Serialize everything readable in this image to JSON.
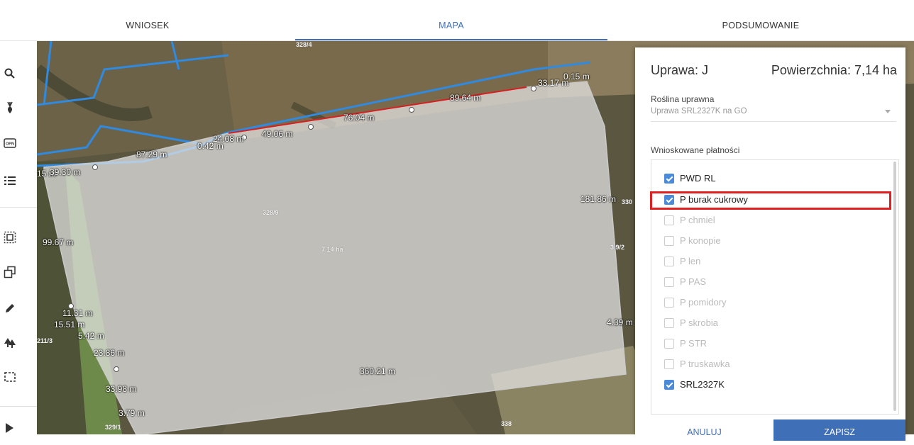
{
  "tabs": [
    {
      "label": "WNIOSEK",
      "active": false
    },
    {
      "label": "MAPA",
      "active": true
    },
    {
      "label": "PODSUMOWANIE",
      "active": false
    }
  ],
  "toolbar": {
    "items": [
      "search-icon",
      "beet-icon",
      "opn-icon",
      "list-icon",
      "select-area-icon",
      "copy-icon",
      "pencil-icon",
      "trees-icon",
      "crop-select-icon",
      "play-icon"
    ],
    "opn_text": "OPN"
  },
  "map": {
    "parcel_labels": [
      "328/4",
      "328/9",
      "7.14 ha",
      "3.9/2",
      "330",
      "211/3",
      "329/1",
      "338"
    ],
    "measurements": [
      "0.15 m",
      "33.17 m",
      "89.64 m",
      "76.04 m",
      "49.06 m",
      "24.08 m",
      "0.42 m",
      "87.29 m",
      "15 m",
      "39.30 m",
      "181.86 m",
      "99.67 m",
      "11.31 m",
      "15.51 m",
      "5.42 m",
      "23.86 m",
      "4.39 m",
      "360.21 m",
      "33.98 m",
      "3.79 m"
    ]
  },
  "panel": {
    "uprawa_label": "Uprawa: J",
    "area_label": "Powierzchnia: 7,14 ha",
    "crop_label": "Roślina uprawna",
    "crop_value": "Uprawa SRL2327K na GO",
    "payments_label": "Wnioskowane płatności",
    "payments": [
      {
        "label": "PWD RL",
        "checked": true,
        "enabled": true
      },
      {
        "label": "P burak cukrowy",
        "checked": true,
        "enabled": true
      },
      {
        "label": "P chmiel",
        "checked": false,
        "enabled": false
      },
      {
        "label": "P konopie",
        "checked": false,
        "enabled": false
      },
      {
        "label": "P len",
        "checked": false,
        "enabled": false
      },
      {
        "label": "P PAS",
        "checked": false,
        "enabled": false
      },
      {
        "label": "P pomidory",
        "checked": false,
        "enabled": false
      },
      {
        "label": "P skrobia",
        "checked": false,
        "enabled": false
      },
      {
        "label": "P STR",
        "checked": false,
        "enabled": false
      },
      {
        "label": "P truskawka",
        "checked": false,
        "enabled": false
      },
      {
        "label": "SRL2327K",
        "checked": true,
        "enabled": true
      }
    ],
    "cancel_label": "ANULUJ",
    "save_label": "ZAPISZ"
  },
  "colors": {
    "accent": "#3f6fb6",
    "checkbox": "#4a8ad8",
    "highlight": "#e02020",
    "parcel_edge": "#d42020",
    "field_boundary": "#2f8ae0"
  }
}
